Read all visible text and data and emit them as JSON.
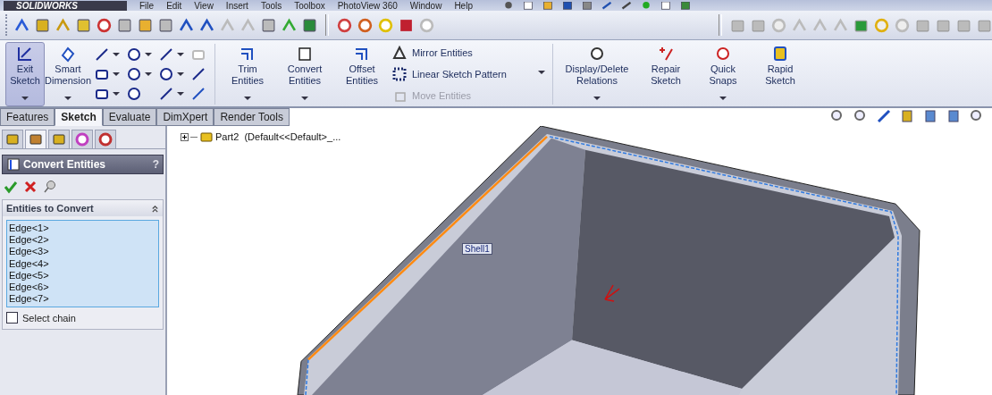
{
  "menu_bar": {
    "logo": "SOLIDWORKS",
    "items": [
      "File",
      "Edit",
      "View",
      "Insert",
      "Tools",
      "Toolbox",
      "PhotoView 360",
      "Window",
      "Help"
    ]
  },
  "command_manager": {
    "buttons": [
      {
        "label": "Exit Sketch",
        "selected": true,
        "dropdown": true
      },
      {
        "label": "Smart Dimension",
        "selected": false,
        "dropdown": true
      }
    ],
    "entity_tools": [
      {
        "label": "Trim Entities",
        "dropdown": true
      },
      {
        "label": "Convert Entities",
        "dropdown": true
      },
      {
        "label": "Offset Entities",
        "dropdown": false
      }
    ],
    "pattern_tools": [
      {
        "label": "Mirror Entities",
        "disabled": false
      },
      {
        "label": "Linear Sketch Pattern",
        "disabled": false
      },
      {
        "label": "Move Entities",
        "disabled": true
      }
    ],
    "relation_tools": [
      {
        "label": "Display/Delete Relations",
        "dropdown": true
      },
      {
        "label": "Repair Sketch",
        "dropdown": false
      },
      {
        "label": "Quick Snaps",
        "dropdown": true
      },
      {
        "label": "Rapid Sketch",
        "dropdown": false
      }
    ]
  },
  "tabs": [
    {
      "label": "Features",
      "selected": false
    },
    {
      "label": "Sketch",
      "selected": true
    },
    {
      "label": "Evaluate",
      "selected": false
    },
    {
      "label": "DimXpert",
      "selected": false
    },
    {
      "label": "Render Tools",
      "selected": false
    }
  ],
  "property_manager": {
    "tabs": [
      {
        "selected": false
      },
      {
        "selected": true
      },
      {
        "selected": false
      },
      {
        "selected": false
      },
      {
        "selected": false
      }
    ],
    "title": "Convert Entities",
    "help": "?",
    "section": {
      "title": "Entities to Convert",
      "items": [
        "Edge<1>",
        "Edge<2>",
        "Edge<3>",
        "Edge<4>",
        "Edge<5>",
        "Edge<6>",
        "Edge<7>"
      ]
    },
    "select_chain": {
      "label": "Select chain",
      "checked": false
    }
  },
  "feature_tree": {
    "item": "Part2  (Default<<Default>_..."
  },
  "viewport": {
    "label": "Shell1"
  }
}
